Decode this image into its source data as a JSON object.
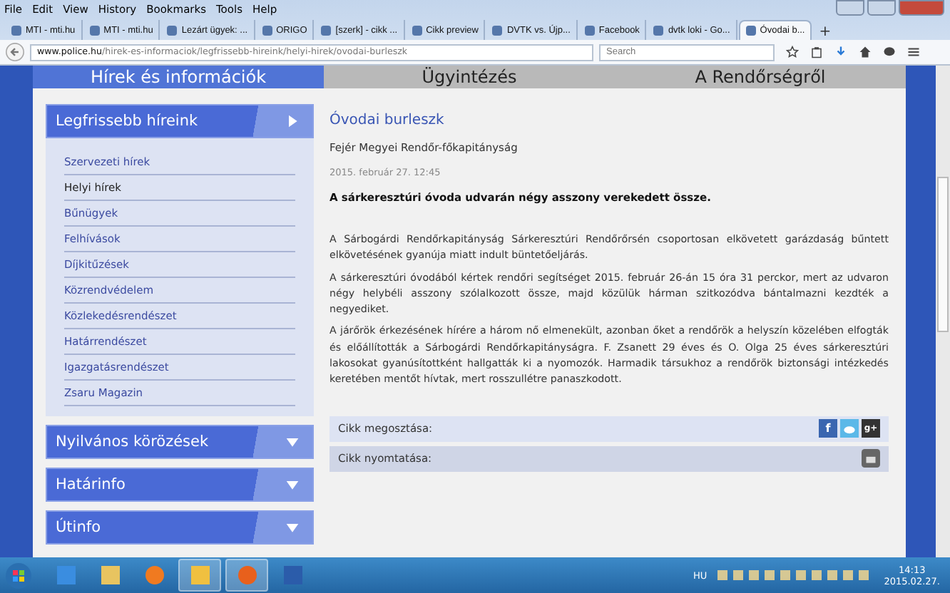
{
  "menu": [
    "File",
    "Edit",
    "View",
    "History",
    "Bookmarks",
    "Tools",
    "Help"
  ],
  "tabs": [
    {
      "title": "MTI - mti.hu",
      "selected": false
    },
    {
      "title": "MTI - mti.hu",
      "selected": false
    },
    {
      "title": "Lezárt ügyek: ...",
      "selected": false
    },
    {
      "title": "ORIGO",
      "selected": false
    },
    {
      "title": "[szerk] - cikk ...",
      "selected": false
    },
    {
      "title": "Cikk preview",
      "selected": false
    },
    {
      "title": "DVTK vs. Újp...",
      "selected": false
    },
    {
      "title": "Facebook",
      "selected": false
    },
    {
      "title": "dvtk loki - Go...",
      "selected": false
    },
    {
      "title": "Óvodai b...",
      "selected": true
    }
  ],
  "new_tab": "+",
  "address": {
    "host": "www.police.hu",
    "path": "/hirek-es-informaciok/legfrissebb-hireink/helyi-hirek/ovodai-burleszk"
  },
  "search": {
    "placeholder": "Search"
  },
  "site_nav": [
    {
      "label": "Hírek és információk",
      "selected": true
    },
    {
      "label": "Ügyintézés",
      "selected": false
    },
    {
      "label": "A Rendőrségről",
      "selected": false
    }
  ],
  "sidebar": [
    {
      "title": "Legfrissebb híreink",
      "expanded": true,
      "items": [
        {
          "label": "Szervezeti hírek",
          "selected": false
        },
        {
          "label": "Helyi hírek",
          "selected": true
        },
        {
          "label": "Bűnügyek",
          "selected": false
        },
        {
          "label": "Felhívások",
          "selected": false
        },
        {
          "label": "Díjkitűzések",
          "selected": false
        },
        {
          "label": "Közrendvédelem",
          "selected": false
        },
        {
          "label": "Közlekedésrendészet",
          "selected": false
        },
        {
          "label": "Határrendészet",
          "selected": false
        },
        {
          "label": "Igazgatásrendészet",
          "selected": false
        },
        {
          "label": "Zsaru Magazin",
          "selected": false
        }
      ]
    },
    {
      "title": "Nyilvános körözések",
      "expanded": false
    },
    {
      "title": "Határinfo",
      "expanded": false
    },
    {
      "title": "Útinfo",
      "expanded": false
    }
  ],
  "article": {
    "title": "Óvodai burleszk",
    "source": "Fejér Megyei Rendőr-főkapitányság",
    "date": "2015. február 27. 12:45",
    "lead": "A sárkeresztúri óvoda udvarán négy asszony verekedett össze.",
    "paragraphs": [
      "A Sárbogárdi Rendőrkapitányság Sárkeresztúri Rendőrőrsén csoportosan elkövetett garázdaság bűntett elkövetésének gyanúja miatt indult büntetőeljárás.",
      "A sárkeresztúri óvodából kértek rendőri segítséget 2015. február 26-án 15 óra 31 perckor, mert az udvaron négy helybéli asszony szólalkozott össze, majd közülük hárman szitkozódva bántalmazni kezdték a negyediket.",
      "A járőrök érkezésének hírére a három nő elmenekült, azonban őket a rendőrök a helyszín közelében elfogták és előállították a Sárbogárdi Rendőrkapitányságra. F. Zsanett 29 éves és O. Olga 25 éves sárkeresztúri lakosokat gyanúsítottként hallgatták ki a nyomozók. Harmadik társukhoz a rendőrök biztonsági intézkedés keretében mentőt hívtak, mert rosszullétre panaszkodott."
    ],
    "actions": [
      {
        "label": "Cikk megosztása:",
        "kind": "share",
        "icons": [
          {
            "kind": "facebook",
            "glyph": "f"
          },
          {
            "kind": "twitter"
          },
          {
            "kind": "google",
            "glyph": "g+"
          }
        ]
      },
      {
        "label": "Cikk nyomtatása:",
        "kind": "print"
      }
    ]
  },
  "taskbar": {
    "language": "HU",
    "time": "14:13",
    "date": "2015.02.27."
  }
}
